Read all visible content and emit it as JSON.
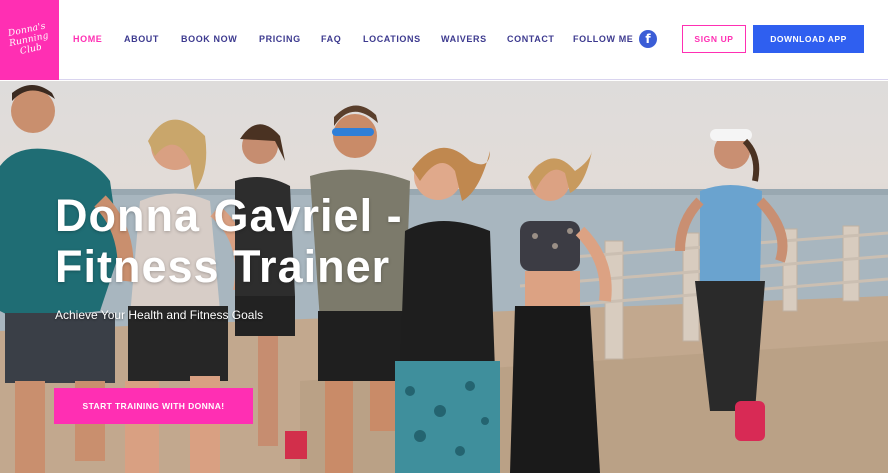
{
  "brand": {
    "logo_text": "Donna's\nRunning\nClub",
    "accent_color": "#ff2fb3",
    "nav_text_color": "#3d3a8f",
    "button_blue": "#2f5ff0"
  },
  "nav": {
    "items": [
      {
        "label": "HOME",
        "active": true
      },
      {
        "label": "ABOUT"
      },
      {
        "label": "BOOK NOW"
      },
      {
        "label": "PRICING"
      },
      {
        "label": "FAQ"
      },
      {
        "label": "LOCATIONS"
      },
      {
        "label": "WAIVERS"
      },
      {
        "label": "CONTACT"
      },
      {
        "label": "FOLLOW ME"
      }
    ],
    "social_icon": "facebook-icon",
    "social_glyph": "f"
  },
  "header_buttons": {
    "signup_label": "SIGN UP",
    "download_label": "DOWNLOAD APP"
  },
  "hero": {
    "title_line1": "Donna Gavriel -",
    "title_line2": "Fitness Trainer",
    "subtitle": "Achieve Your Health and Fitness Goals",
    "cta_label": "START TRAINING WITH DONNA!"
  }
}
